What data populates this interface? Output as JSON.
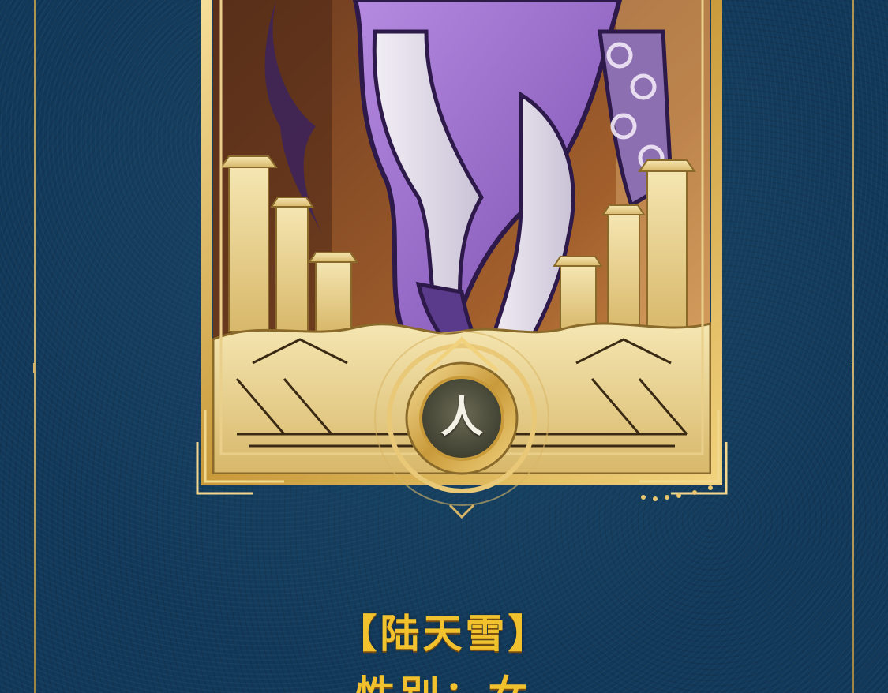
{
  "character": {
    "name_open_bracket": "【",
    "name": "陆天雪",
    "name_close_bracket": "】",
    "gender_line": "性别：女"
  },
  "emblem": {
    "glyph": "人"
  },
  "colors": {
    "background": "#12395a",
    "gold": "#d8b566",
    "title_gold": "#f2c12e",
    "robe_purple": "#9a6ac8"
  },
  "icons": [
    "emblem-badge-icon",
    "card-frame-icon"
  ]
}
